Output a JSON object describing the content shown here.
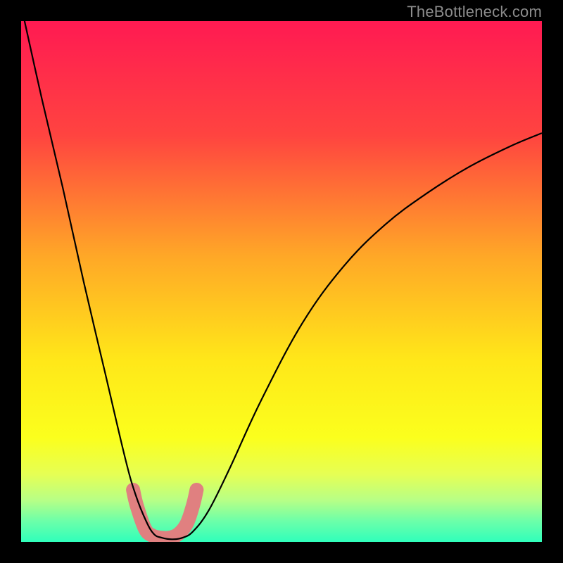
{
  "watermark": "TheBottleneck.com",
  "gradient_stops": [
    {
      "offset": 0,
      "color": "#ff1a52"
    },
    {
      "offset": 22,
      "color": "#ff4440"
    },
    {
      "offset": 45,
      "color": "#ffa727"
    },
    {
      "offset": 65,
      "color": "#ffe719"
    },
    {
      "offset": 80,
      "color": "#fbff1d"
    },
    {
      "offset": 87,
      "color": "#e6ff54"
    },
    {
      "offset": 92,
      "color": "#b7ff86"
    },
    {
      "offset": 96,
      "color": "#6cffa9"
    },
    {
      "offset": 100,
      "color": "#30ffbb"
    }
  ],
  "chart_data": {
    "type": "line",
    "title": "",
    "xlabel": "",
    "ylabel": "",
    "xlim": [
      0,
      100
    ],
    "ylim": [
      0,
      100
    ],
    "series": [
      {
        "name": "bottleneck-curve",
        "x": [
          0,
          4,
          8,
          12,
          16,
          20,
          22,
          24,
          25.5,
          27,
          29,
          31,
          33,
          36,
          40,
          46,
          54,
          62,
          70,
          78,
          86,
          94,
          100
        ],
        "y": [
          103,
          85,
          68,
          50,
          33,
          16,
          9,
          4,
          1.5,
          0.8,
          0.5,
          0.8,
          2,
          6,
          14,
          27,
          42,
          53,
          61,
          67,
          72,
          76,
          78.5
        ]
      },
      {
        "name": "marker-band",
        "x": [
          21.5,
          22.2,
          23.8,
          25.2,
          26.8,
          28.5,
          30.2,
          31.8,
          33.0,
          33.7
        ],
        "y": [
          10.0,
          7.0,
          2.5,
          1.2,
          0.8,
          0.8,
          1.5,
          3.5,
          7.0,
          10.0
        ]
      }
    ]
  }
}
